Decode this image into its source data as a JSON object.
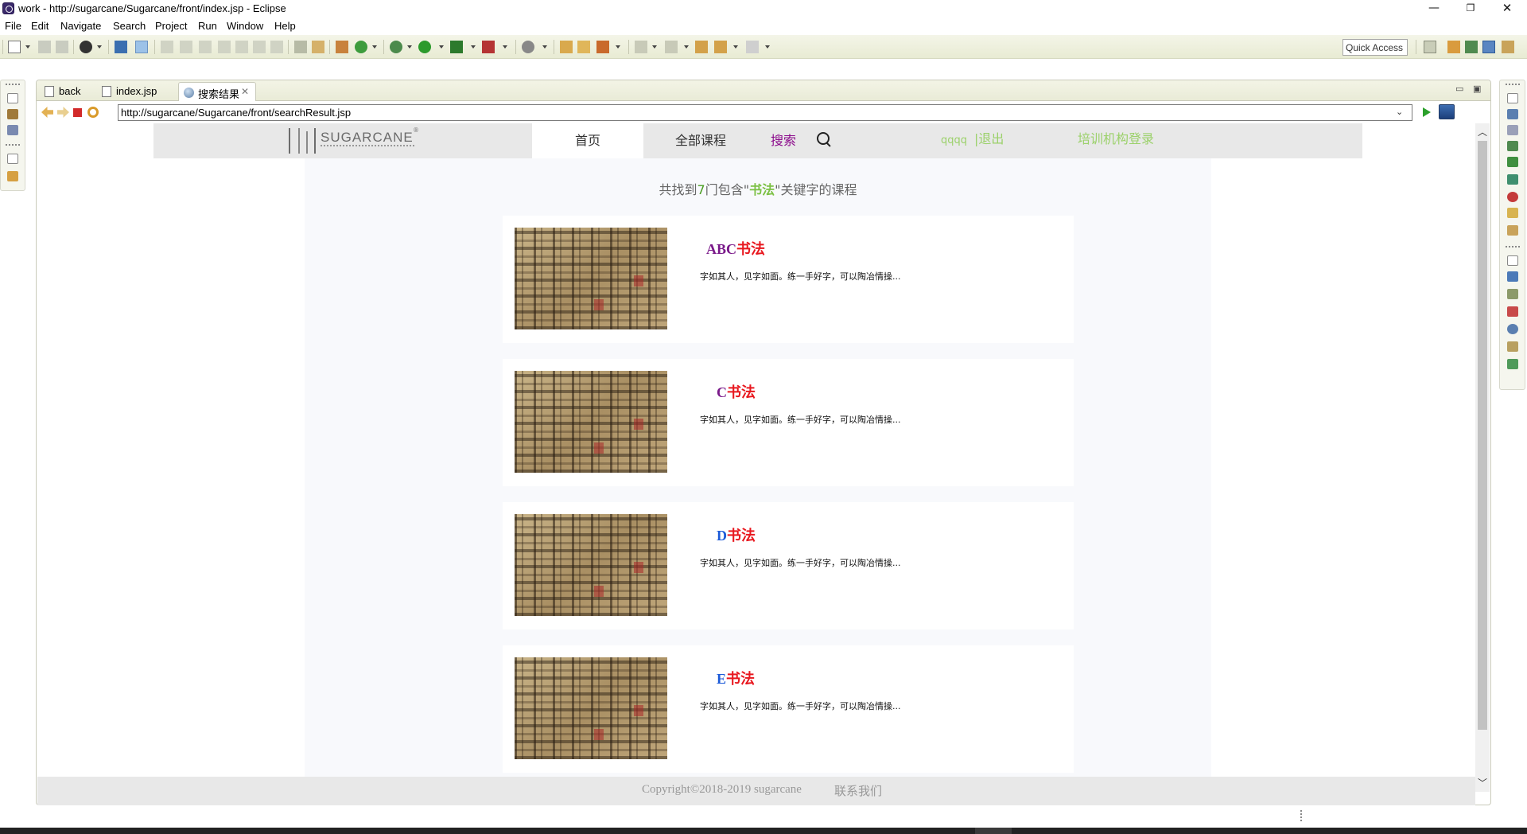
{
  "window": {
    "title": "work - http://sugarcane/Sugarcane/front/index.jsp - Eclipse",
    "controls": {
      "minimize": "—",
      "maximize": "❐",
      "close": "✕"
    }
  },
  "menubar": [
    "File",
    "Edit",
    "Navigate",
    "Search",
    "Project",
    "Run",
    "Window",
    "Help"
  ],
  "toolbar": {
    "quick_access": "Quick Access"
  },
  "editor": {
    "tabs": [
      {
        "label": "back",
        "icon": "jsp-file-icon"
      },
      {
        "label": "index.jsp",
        "icon": "jsp-file-icon"
      },
      {
        "label": "搜索结果",
        "icon": "web-browser-globe-icon",
        "active": true
      }
    ],
    "tab_close": "✕"
  },
  "browser": {
    "url": "http://sugarcane/Sugarcane/front/searchResult.jsp"
  },
  "site": {
    "logo_text": "SUGARCANE",
    "logo_reg": "®",
    "nav": {
      "home": "首页",
      "courses": "全部课程",
      "search": "搜索",
      "user": "qqqq",
      "separator": "|",
      "logout": "退出",
      "org_login": "培训机构登录"
    },
    "summary": {
      "prefix": "共找到",
      "count": "7",
      "middle": "门包含\"",
      "keyword": "书法",
      "suffix": "\"关键字的课程"
    },
    "courses": [
      {
        "prefix": "ABC",
        "word": "书法",
        "desc": "字如其人，见字如面。练一手好字，可以陶冶情操...",
        "prefix_color": "#7a1a8a"
      },
      {
        "prefix": "C",
        "word": "书法",
        "desc": "字如其人，见字如面。练一手好字，可以陶冶情操...",
        "prefix_color": "#7a1a8a"
      },
      {
        "prefix": "D",
        "word": "书法",
        "desc": "字如其人，见字如面。练一手好字，可以陶冶情操...",
        "prefix_color": "#1d5bd8"
      },
      {
        "prefix": "E",
        "word": "书法",
        "desc": "字如其人，见字如面。练一手好字，可以陶冶情操...",
        "prefix_color": "#1d5bd8"
      }
    ],
    "footer": {
      "copyright": "Copyright©2018-2019   sugarcane",
      "contact": "联系我们"
    }
  },
  "colors": {
    "accent_green": "#9bd16a",
    "search_purple": "#8b0a8b",
    "title_red": "#e8171e"
  }
}
